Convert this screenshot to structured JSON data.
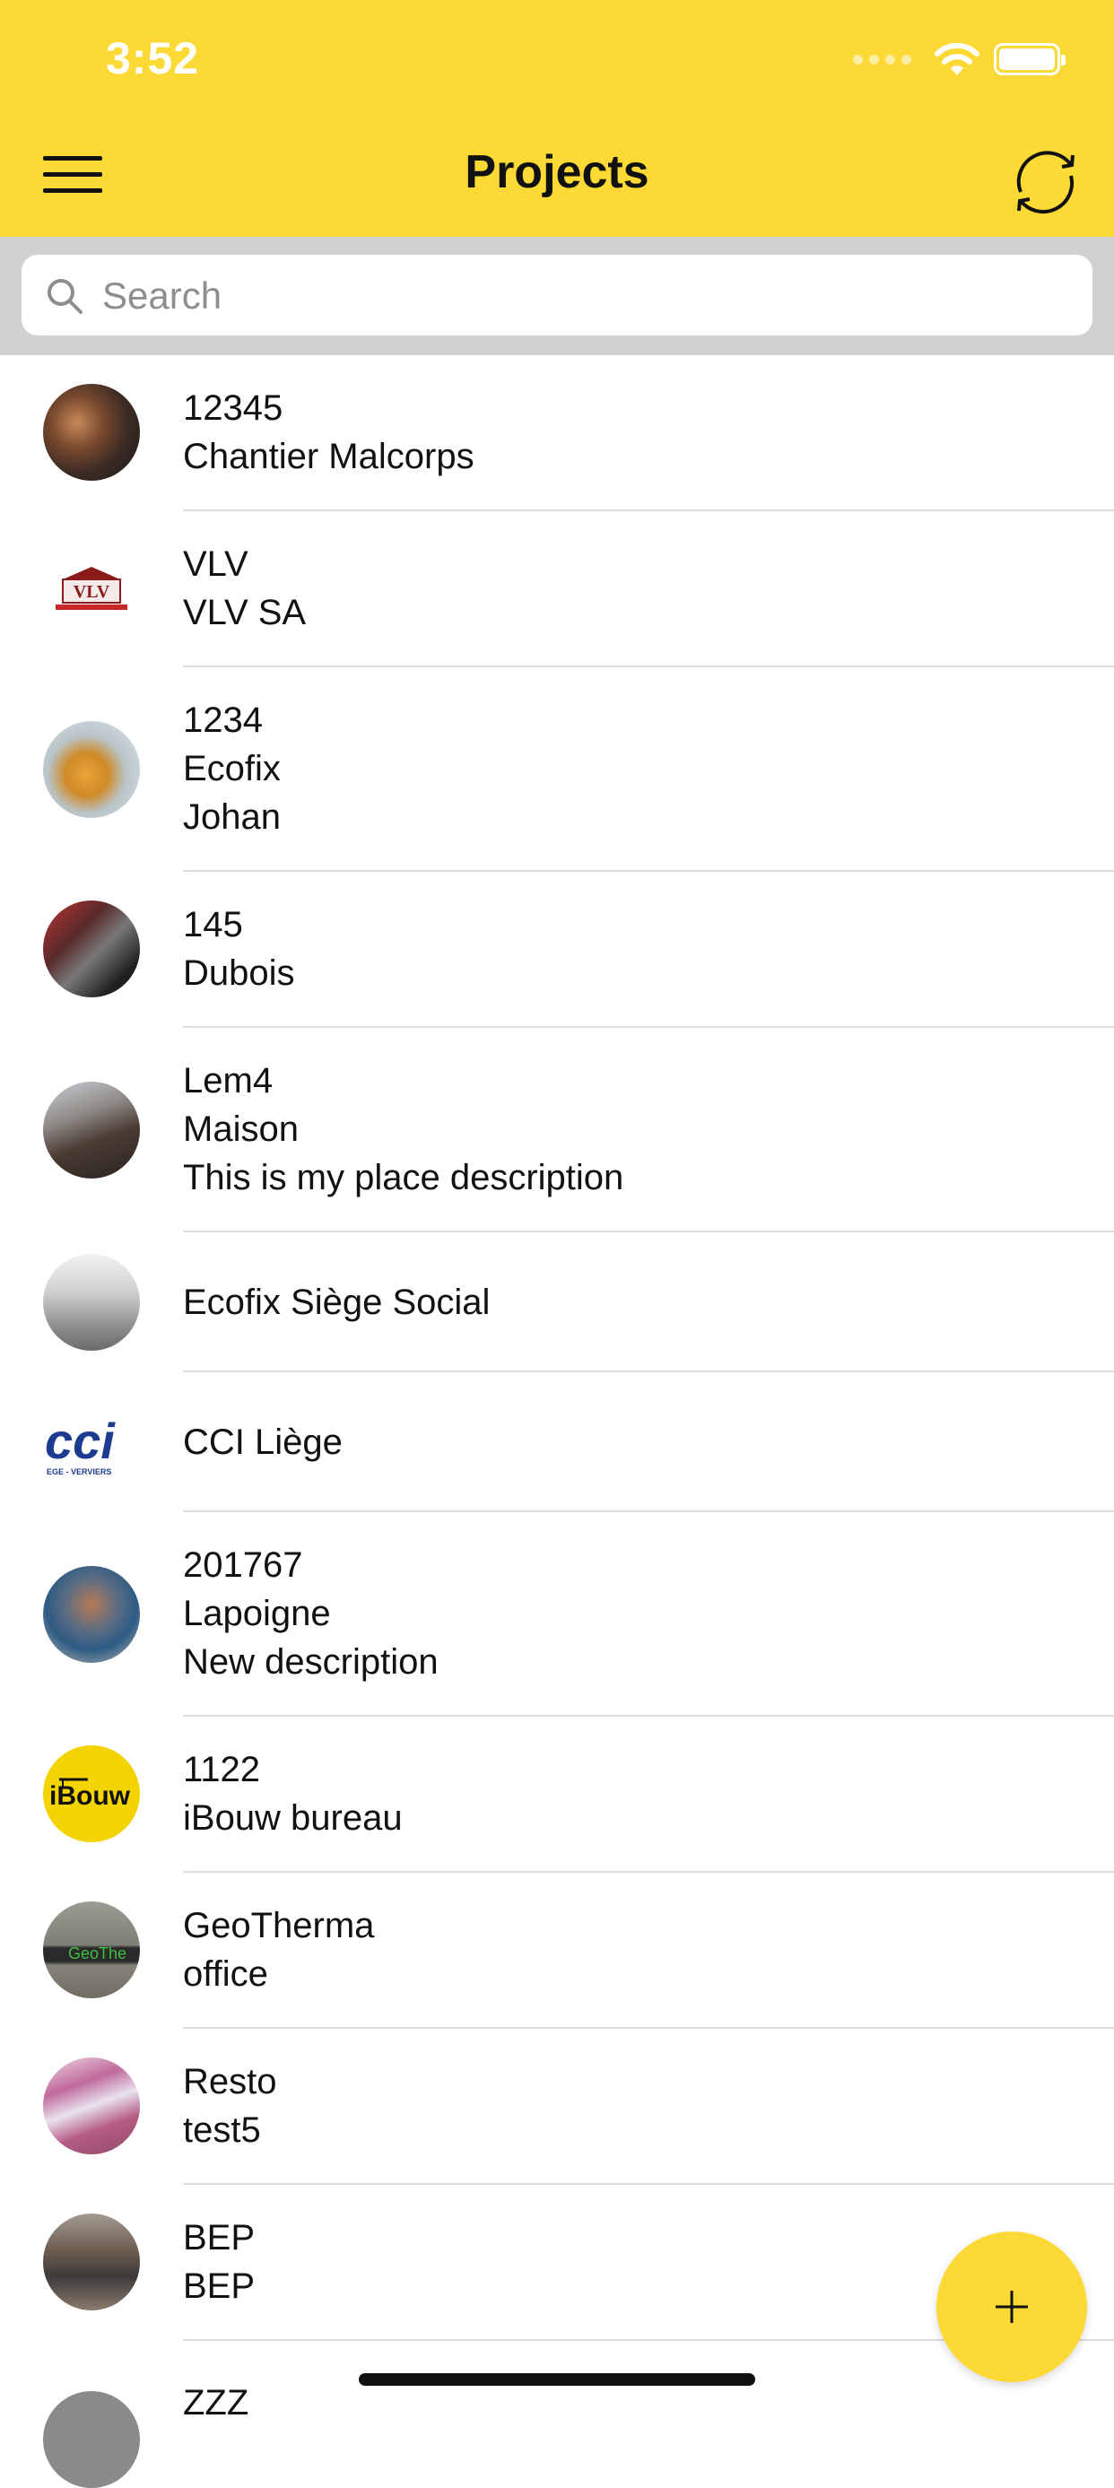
{
  "status_bar": {
    "time": "3:52"
  },
  "header": {
    "title": "Projects",
    "menu_icon": "hamburger-menu-icon",
    "sync_icon": "sync-icon"
  },
  "search": {
    "placeholder": "Search",
    "value": ""
  },
  "projects": [
    {
      "lines": [
        "12345",
        "Chantier Malcorps"
      ]
    },
    {
      "lines": [
        "VLV",
        "VLV SA"
      ]
    },
    {
      "lines": [
        "1234",
        "Ecofix",
        "Johan"
      ]
    },
    {
      "lines": [
        "145",
        "Dubois"
      ]
    },
    {
      "lines": [
        "Lem4",
        "Maison",
        "This is my place description"
      ]
    },
    {
      "lines": [
        "Ecofix Siège Social"
      ]
    },
    {
      "lines": [
        "CCI Liège"
      ]
    },
    {
      "lines": [
        "201767",
        "Lapoigne",
        "New description"
      ]
    },
    {
      "lines": [
        "1122",
        "iBouw bureau"
      ]
    },
    {
      "lines": [
        "GeoTherma",
        "office"
      ]
    },
    {
      "lines": [
        "Resto",
        "test5"
      ]
    },
    {
      "lines": [
        "BEP",
        "BEP"
      ]
    },
    {
      "lines": [
        "ZZZ"
      ]
    }
  ],
  "logos": {
    "vlv": "VLV",
    "cci": "cci",
    "cci_sub": "EGE - VERVIERS",
    "ibouw": "iBouw",
    "geotherma": "GeoThe"
  },
  "fab": {
    "icon": "plus-icon"
  },
  "colors": {
    "accent": "#fcd935",
    "search_bg": "#d1d1d1",
    "divider": "#dcdcdc"
  }
}
